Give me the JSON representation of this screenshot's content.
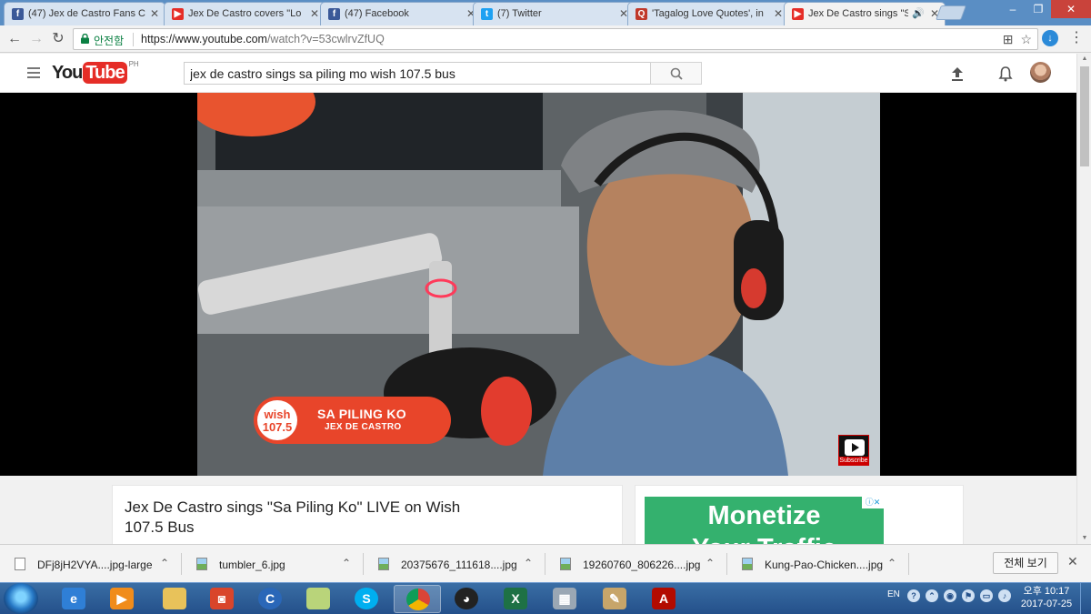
{
  "browser": {
    "tabs": [
      {
        "label": "(47) Jex de Castro Fans C",
        "icon": "facebook-icon",
        "color": "#3b5998"
      },
      {
        "label": "Jex De Castro covers \"Lo",
        "icon": "youtube-icon",
        "color": "#e52d27"
      },
      {
        "label": "(47) Facebook",
        "icon": "facebook-icon",
        "color": "#3b5998"
      },
      {
        "label": "(7) Twitter",
        "icon": "twitter-icon",
        "color": "#1da1f2"
      },
      {
        "label": "'Tagalog Love Quotes', in",
        "icon": "site-icon",
        "color": "#c0392b"
      },
      {
        "label": "Jex De Castro sings \"S",
        "icon": "youtube-icon",
        "color": "#e52d27"
      }
    ],
    "secure_label": "안전함",
    "url_host": "https://www.youtube.com",
    "url_rest": "/watch?v=53cwlrvZfUQ"
  },
  "youtube": {
    "logo_you": "You",
    "logo_tube": "Tube",
    "region": "PH",
    "search_value": "jex de castro sings sa piling mo wish 107.5 bus"
  },
  "video": {
    "lower_third_logo": "wish 107.5",
    "lower_third_title": "SA PILING KO",
    "lower_third_artist": "JEX DE CASTRO",
    "subscribe_label": "Subscribe",
    "title": "Jex De Castro sings \"Sa Piling Ko\" LIVE on Wish 107.5 Bus"
  },
  "ad": {
    "line1": "Monetize",
    "line2": "Your Traffic"
  },
  "downloads": {
    "items": [
      "DFj8jH2VYA....jpg-large",
      "tumbler_6.jpg",
      "20375676_111618....jpg",
      "19260760_806226....jpg",
      "Kung-Pao-Chicken....jpg"
    ],
    "show_all": "전체 보기"
  },
  "taskbar": {
    "lang": "EN",
    "time": "오후 10:17",
    "date": "2017-07-25"
  }
}
